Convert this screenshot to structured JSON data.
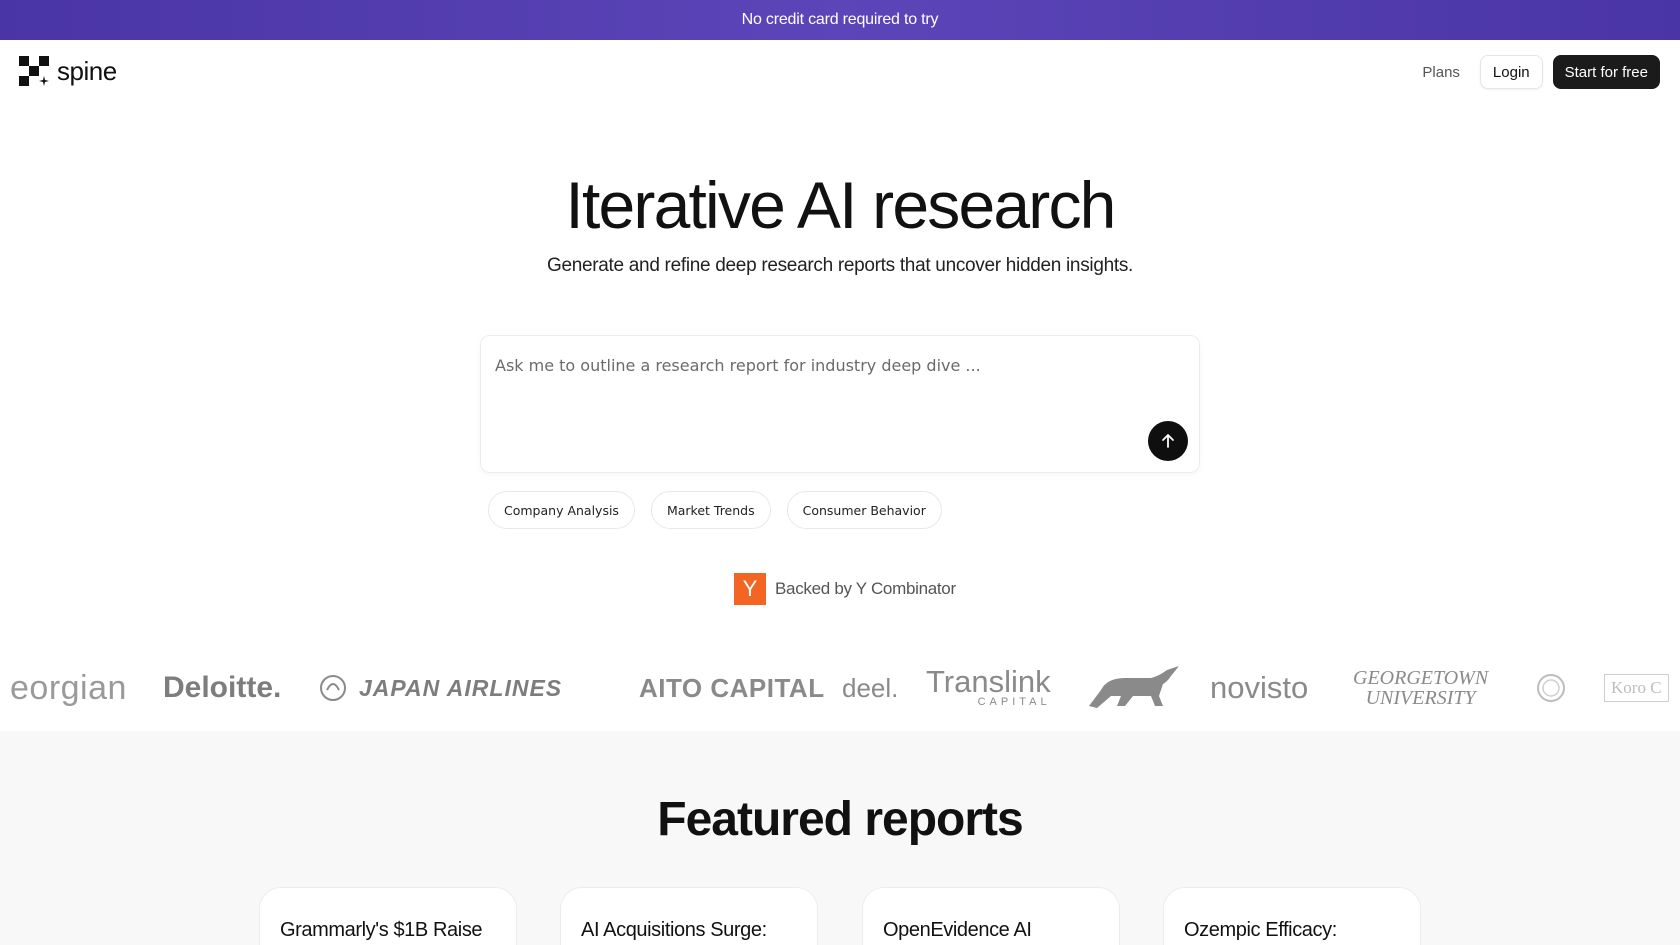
{
  "banner": {
    "text": "No credit card required to try",
    "color": "#5341ad"
  },
  "nav": {
    "logo_text": "spine",
    "plans": "Plans",
    "login": "Login",
    "start": "Start for free"
  },
  "hero": {
    "title": "Iterative AI research",
    "subtitle": "Generate and refine deep research reports that uncover hidden insights."
  },
  "prompt": {
    "placeholder": "Ask me to outline a research report for industry deep dive ...",
    "send_icon": "arrow-up-icon"
  },
  "chips": [
    "Company Analysis",
    "Market Trends",
    "Consumer Behavior"
  ],
  "backed": {
    "badge": "Y",
    "text": "Backed by Y Combinator",
    "badge_color": "#f26522"
  },
  "logos": {
    "georgian": "eorgian",
    "deloitte": "Deloitte.",
    "jal": "JAPAN AIRLINES",
    "aito": "AITO CAPITAL",
    "deel": "deel.",
    "translink_top": "Translink",
    "translink_bottom": "CAPITAL",
    "bull": "bull-logo",
    "novisto": "novisto",
    "georgetown_top": "GEORGETOWN",
    "georgetown_bottom": "UNIVERSITY",
    "seal": "university-seal-logo",
    "koro": "Koro C"
  },
  "featured": {
    "title": "Featured reports",
    "cards": [
      "Grammarly's $1B Raise",
      "AI Acquisitions Surge:",
      "OpenEvidence AI",
      "Ozempic Efficacy:"
    ]
  }
}
